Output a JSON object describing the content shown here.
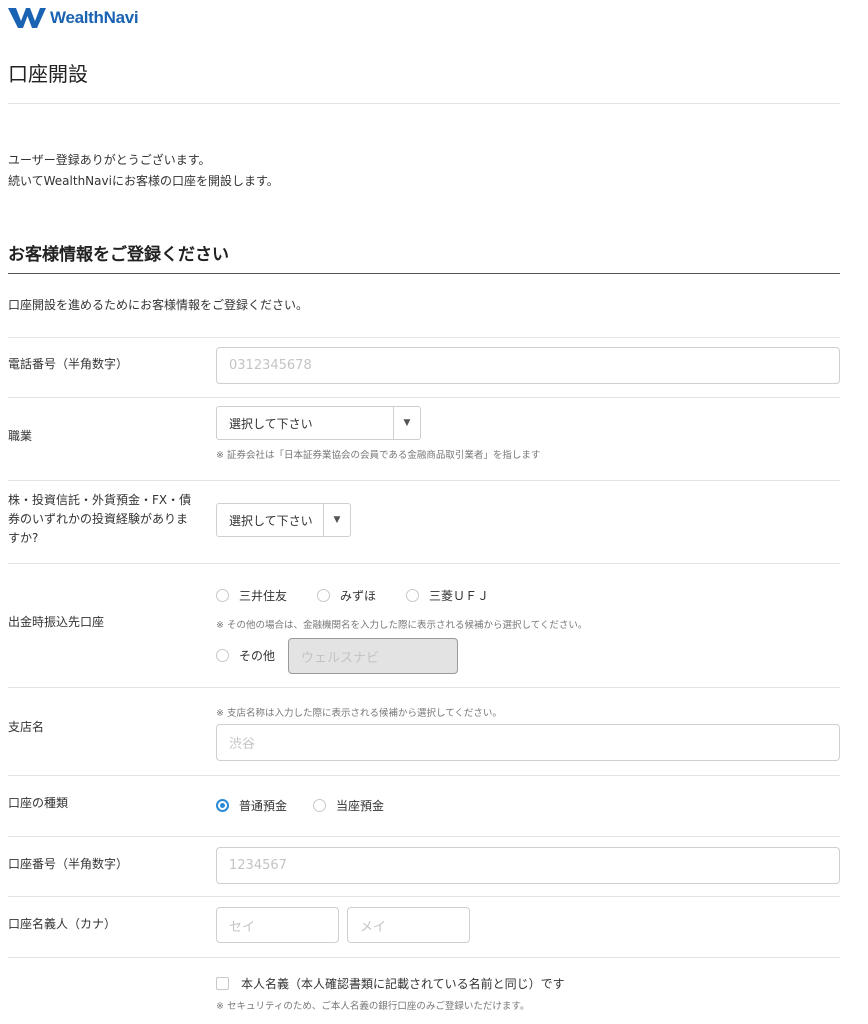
{
  "brand": {
    "name": "WealthNavi",
    "logo_icon": "wealthnavi-w-icon",
    "color": "#1a63b3"
  },
  "page_title": "口座開設",
  "intro": {
    "line1": "ユーザー登録ありがとうございます。",
    "line2": "続いてWealthNaviにお客様の口座を開設します。"
  },
  "section": {
    "title": "お客様情報をご登録ください",
    "description": "口座開設を進めるためにお客様情報をご登録ください。"
  },
  "form": {
    "phone": {
      "label": "電話番号（半角数字）",
      "placeholder": "0312345678"
    },
    "occupation": {
      "label": "職業",
      "select_value": "選択して下さい",
      "note": "※ 証券会社は「日本証券業協会の会員である金融商品取引業者」を指します"
    },
    "experience": {
      "label_line1": "株・投資信託・外貨預金・FX・債",
      "label_line2": "券のいずれかの投資経験がありま",
      "label_line3": "すか?",
      "select_value": "選択して下さい"
    },
    "bank": {
      "label": "出金時振込先口座",
      "options": [
        "三井住友",
        "みずほ",
        "三菱ＵＦＪ"
      ],
      "note": "※ その他の場合は、金融機関名を入力した際に表示される候補から選択してください。",
      "other_label": "その他",
      "other_placeholder": "ウェルスナビ"
    },
    "branch": {
      "label": "支店名",
      "note": "※ 支店名称は入力した際に表示される候補から選択してください。",
      "placeholder": "渋谷"
    },
    "account_type": {
      "label": "口座の種類",
      "options": [
        "普通預金",
        "当座預金"
      ],
      "selected": "普通預金",
      "accent_color": "#2b8ad6"
    },
    "account_number": {
      "label": "口座番号（半角数字）",
      "placeholder": "1234567"
    },
    "account_holder": {
      "label": "口座名義人（カナ）",
      "placeholder_sei": "セイ",
      "placeholder_mei": "メイ"
    },
    "same_name": {
      "label": "本人名義（本人確認書類に記載されている名前と同じ）です",
      "note": "※ セキュリティのため、ご本人名義の銀行口座のみご登録いただけます。"
    }
  }
}
